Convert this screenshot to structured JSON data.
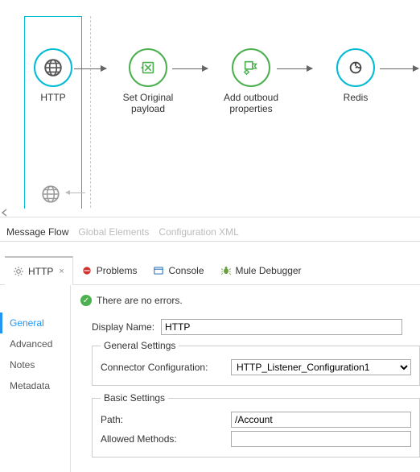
{
  "flow": {
    "nodes": [
      {
        "label": "HTTP"
      },
      {
        "label": "Set Original payload"
      },
      {
        "label": "Add outboud properties"
      },
      {
        "label": "Redis"
      }
    ]
  },
  "editorTabs": {
    "messageFlow": "Message Flow",
    "globalElements": "Global Elements",
    "configXml": "Configuration XML"
  },
  "viewTabs": {
    "http": "HTTP",
    "problems": "Problems",
    "console": "Console",
    "muleDebugger": "Mule Debugger"
  },
  "status": {
    "text": "There are no errors."
  },
  "sideMenu": {
    "general": "General",
    "advanced": "Advanced",
    "notes": "Notes",
    "metadata": "Metadata"
  },
  "form": {
    "displayNameLabel": "Display Name:",
    "displayNameValue": "HTTP",
    "generalSettingsLegend": "General Settings",
    "connectorConfigLabel": "Connector Configuration:",
    "connectorConfigValue": "HTTP_Listener_Configuration1",
    "basicSettingsLegend": "Basic Settings",
    "pathLabel": "Path:",
    "pathValue": "/Account",
    "allowedMethodsLabel": "Allowed Methods:",
    "allowedMethodsValue": ""
  }
}
